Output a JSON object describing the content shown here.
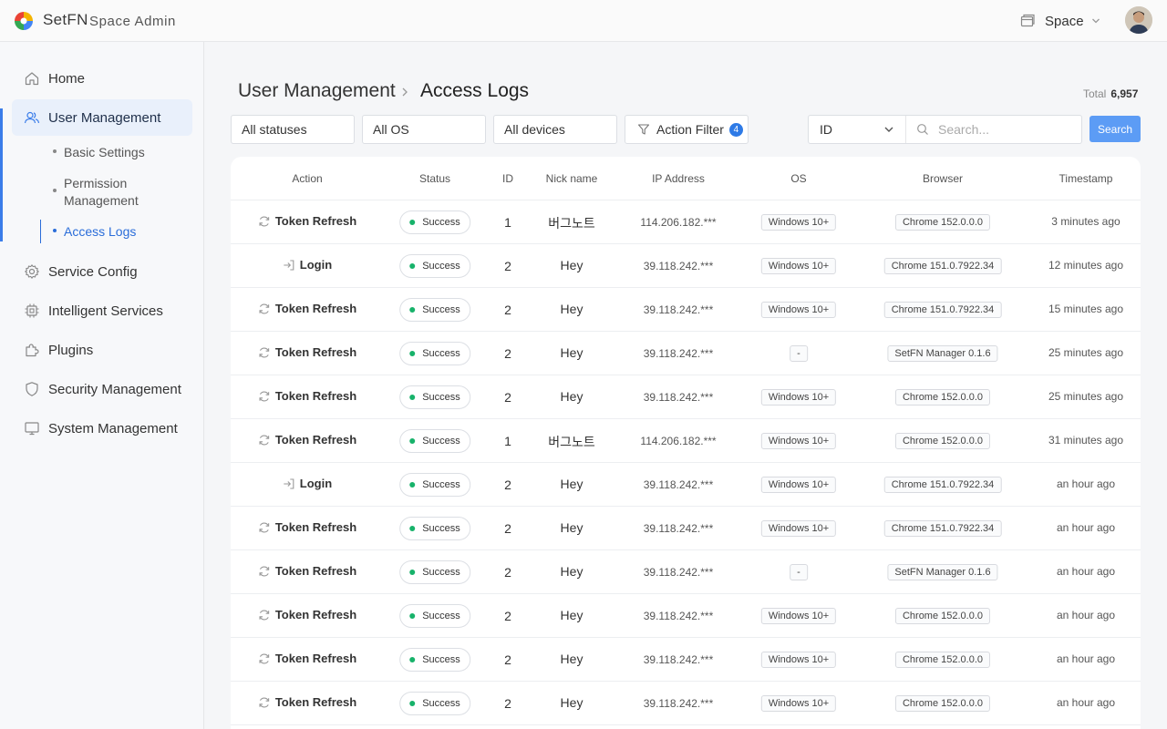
{
  "header": {
    "brand": "SetFN",
    "subtitle": "Space Admin",
    "space_label": "Space"
  },
  "sidebar": {
    "items": [
      {
        "label": "Home",
        "icon": "home-icon"
      },
      {
        "label": "User Management",
        "icon": "users-icon"
      },
      {
        "label": "Service Config",
        "icon": "gear-icon"
      },
      {
        "label": "Intelligent Services",
        "icon": "chip-icon"
      },
      {
        "label": "Plugins",
        "icon": "puzzle-icon"
      },
      {
        "label": "Security Management",
        "icon": "shield-icon"
      },
      {
        "label": "System Management",
        "icon": "monitor-icon"
      }
    ],
    "sub_items": [
      {
        "label": "Basic Settings"
      },
      {
        "label": "Permission Management"
      },
      {
        "label": "Access Logs"
      }
    ],
    "active_color": "#3b7de9"
  },
  "page": {
    "breadcrumb_parent": "User Management",
    "breadcrumb_current": "Access Logs",
    "total_label": "Total",
    "total_value": "6,957"
  },
  "filters": {
    "status": "All statuses",
    "os": "All OS",
    "device": "All devices",
    "action_filter": "Action Filter",
    "action_filter_count": "4",
    "search_field": "ID",
    "search_placeholder": "Search...",
    "search_button": "Search"
  },
  "table": {
    "headers": [
      "Action",
      "Status",
      "ID",
      "Nick name",
      "IP Address",
      "OS",
      "Browser",
      "Timestamp"
    ],
    "rows": [
      {
        "action": "Token Refresh",
        "action_icon": "refresh-icon",
        "status": "Success",
        "id": "1",
        "nick": "버그노트",
        "ip": "114.206.182.***",
        "os": "Windows 10+",
        "browser": "Chrome 152.0.0.0",
        "time": "3 minutes ago"
      },
      {
        "action": "Login",
        "action_icon": "login-icon",
        "status": "Success",
        "id": "2",
        "nick": "Hey",
        "ip": "39.118.242.***",
        "os": "Windows 10+",
        "browser": "Chrome 151.0.7922.34",
        "time": "12 minutes ago"
      },
      {
        "action": "Token Refresh",
        "action_icon": "refresh-icon",
        "status": "Success",
        "id": "2",
        "nick": "Hey",
        "ip": "39.118.242.***",
        "os": "Windows 10+",
        "browser": "Chrome 151.0.7922.34",
        "time": "15 minutes ago"
      },
      {
        "action": "Token Refresh",
        "action_icon": "refresh-icon",
        "status": "Success",
        "id": "2",
        "nick": "Hey",
        "ip": "39.118.242.***",
        "os": "-",
        "browser": "SetFN Manager 0.1.6",
        "time": "25 minutes ago"
      },
      {
        "action": "Token Refresh",
        "action_icon": "refresh-icon",
        "status": "Success",
        "id": "2",
        "nick": "Hey",
        "ip": "39.118.242.***",
        "os": "Windows 10+",
        "browser": "Chrome 152.0.0.0",
        "time": "25 minutes ago"
      },
      {
        "action": "Token Refresh",
        "action_icon": "refresh-icon",
        "status": "Success",
        "id": "1",
        "nick": "버그노트",
        "ip": "114.206.182.***",
        "os": "Windows 10+",
        "browser": "Chrome 152.0.0.0",
        "time": "31 minutes ago"
      },
      {
        "action": "Login",
        "action_icon": "login-icon",
        "status": "Success",
        "id": "2",
        "nick": "Hey",
        "ip": "39.118.242.***",
        "os": "Windows 10+",
        "browser": "Chrome 151.0.7922.34",
        "time": "an hour ago"
      },
      {
        "action": "Token Refresh",
        "action_icon": "refresh-icon",
        "status": "Success",
        "id": "2",
        "nick": "Hey",
        "ip": "39.118.242.***",
        "os": "Windows 10+",
        "browser": "Chrome 151.0.7922.34",
        "time": "an hour ago"
      },
      {
        "action": "Token Refresh",
        "action_icon": "refresh-icon",
        "status": "Success",
        "id": "2",
        "nick": "Hey",
        "ip": "39.118.242.***",
        "os": "-",
        "browser": "SetFN Manager 0.1.6",
        "time": "an hour ago"
      },
      {
        "action": "Token Refresh",
        "action_icon": "refresh-icon",
        "status": "Success",
        "id": "2",
        "nick": "Hey",
        "ip": "39.118.242.***",
        "os": "Windows 10+",
        "browser": "Chrome 152.0.0.0",
        "time": "an hour ago"
      },
      {
        "action": "Token Refresh",
        "action_icon": "refresh-icon",
        "status": "Success",
        "id": "2",
        "nick": "Hey",
        "ip": "39.118.242.***",
        "os": "Windows 10+",
        "browser": "Chrome 152.0.0.0",
        "time": "an hour ago"
      },
      {
        "action": "Token Refresh",
        "action_icon": "refresh-icon",
        "status": "Success",
        "id": "2",
        "nick": "Hey",
        "ip": "39.118.242.***",
        "os": "Windows 10+",
        "browser": "Chrome 152.0.0.0",
        "time": "an hour ago"
      }
    ],
    "status_color": "#17b26a"
  }
}
